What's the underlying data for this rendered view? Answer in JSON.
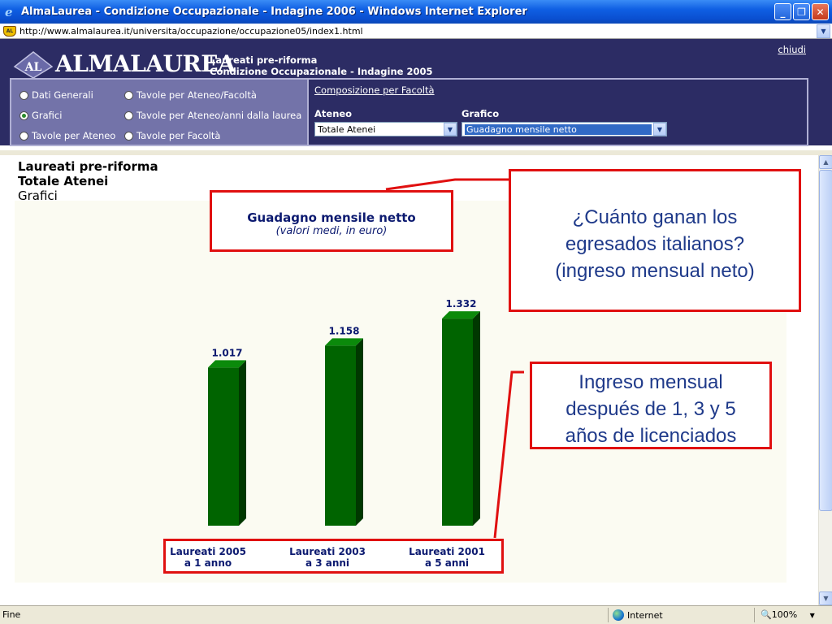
{
  "window": {
    "title": "AlmaLaurea - Condizione Occupazionale - Indagine 2006 - Windows Internet Explorer",
    "minimize_glyph": "_",
    "maximize_glyph": "❐",
    "close_glyph": "✕"
  },
  "address": {
    "url": "http://www.almalaurea.it/universita/occupazione/occupazione05/index1.html",
    "favicon_text": "AL"
  },
  "site": {
    "logo_emblem": "AL",
    "logo_word": "ALMALAUREA",
    "header_line1": "Laureati pre-riforma",
    "header_line2": "Condizione Occupazionale - Indagine 2005",
    "close_link": "chiudi",
    "nav_options": [
      {
        "label": "Dati Generali",
        "selected": false
      },
      {
        "label": "Grafici",
        "selected": true
      },
      {
        "label": "Tavole per Ateneo",
        "selected": false
      },
      {
        "label": "Tavole per Ateneo/Facoltà",
        "selected": false
      },
      {
        "label": "Tavole per Ateneo/anni dalla laurea",
        "selected": false
      },
      {
        "label": "Tavole per Facoltà",
        "selected": false
      }
    ],
    "composition_link": "Composizione per Facoltà",
    "ateneo_label": "Ateneo",
    "ateneo_value": "Totale Atenei",
    "grafico_label": "Grafico",
    "grafico_value": "Guadagno mensile netto"
  },
  "page": {
    "heading1": "Laureati pre-riforma",
    "heading2": "Totale Atenei",
    "heading3": "Grafici"
  },
  "chart_data": {
    "type": "bar",
    "title": "Guadagno mensile netto",
    "subtitle": "(valori medi, in euro)",
    "categories": [
      {
        "line1": "Laureati 2005",
        "line2": "a 1 anno"
      },
      {
        "line1": "Laureati 2003",
        "line2": "a 3 anni"
      },
      {
        "line1": "Laureati 2001",
        "line2": "a 5 anni"
      }
    ],
    "values": [
      1017,
      1158,
      1332
    ],
    "value_labels": [
      "1.017",
      "1.158",
      "1.332"
    ],
    "ylim": [
      0,
      1500
    ],
    "bar_color": "#006400",
    "bar_side_color": "#003800",
    "label_color": "#0c1a70",
    "grid": false
  },
  "annotations": {
    "callout1_lines": [
      "¿Cuánto ganan los",
      "egresados italianos?",
      "(ingreso mensual neto)"
    ],
    "callout2_lines": [
      "Ingreso mensual",
      "después de 1, 3 y 5",
      "años de licenciados"
    ],
    "highlight_color": "#e01010"
  },
  "status": {
    "text": "Fine",
    "zone": "Internet",
    "zoom": "100%",
    "zoom_arrow": "▼"
  }
}
